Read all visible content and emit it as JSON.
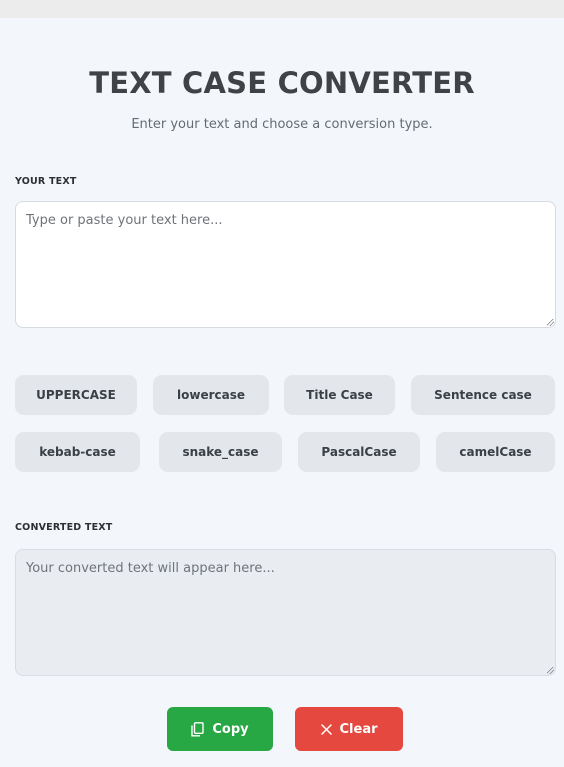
{
  "header": {
    "title": "TEXT CASE CONVERTER",
    "subtitle": "Enter your text and choose a conversion type."
  },
  "input": {
    "label": "YOUR TEXT",
    "placeholder": "Type or paste your text here...",
    "value": ""
  },
  "conversions": [
    {
      "label": "UPPERCASE"
    },
    {
      "label": "lowercase"
    },
    {
      "label": "Title Case"
    },
    {
      "label": "Sentence case"
    },
    {
      "label": "kebab-case"
    },
    {
      "label": "snake_case"
    },
    {
      "label": "PascalCase"
    },
    {
      "label": "camelCase"
    }
  ],
  "output": {
    "label": "CONVERTED TEXT",
    "placeholder": "Your converted text will appear here...",
    "value": ""
  },
  "actions": {
    "copy_label": "Copy",
    "copy_icon": "copy-icon",
    "clear_label": "Clear",
    "clear_icon": "close-icon"
  },
  "colors": {
    "background": "#f3f7fb",
    "copy": "#28a745",
    "clear": "#e5483f",
    "option_button": "#e3e7eb"
  }
}
